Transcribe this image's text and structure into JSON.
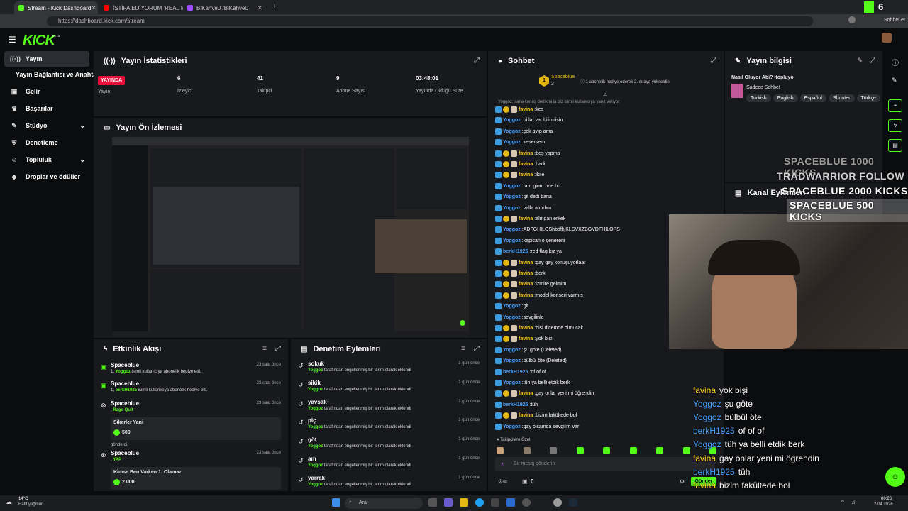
{
  "browser": {
    "tabs": [
      {
        "title": "Stream - Kick Dashboard",
        "color": "#53fc18"
      },
      {
        "title": "İSTİFA EDİYORUM 'REAL MADRİD'",
        "color": "#ff0000"
      },
      {
        "title": "BiKahve0 /BiKahve0",
        "color": "#a24bff"
      }
    ],
    "url": "https://dashboard.kick.com/stream",
    "profile_label": "Sohbet et"
  },
  "app": {
    "logo": "KICK",
    "logo_badge": "BETA"
  },
  "sidebar": {
    "items": [
      {
        "label": "Yayın",
        "icon": "broadcast-icon",
        "glyph": "((·))"
      },
      {
        "label": "Yayın Bağlantısı ve Anahtarı",
        "icon": "",
        "glyph": ""
      },
      {
        "label": "Gelir",
        "icon": "money-icon",
        "glyph": "▣"
      },
      {
        "label": "Başarılar",
        "icon": "trophy-icon",
        "glyph": "♛"
      },
      {
        "label": "Stüdyo",
        "icon": "studio-icon",
        "glyph": "✎"
      },
      {
        "label": "Denetleme",
        "icon": "shield-icon",
        "glyph": "⛨"
      },
      {
        "label": "Topluluk",
        "icon": "community-icon",
        "glyph": "☺"
      },
      {
        "label": "Droplar ve ödüller",
        "icon": "gift-icon",
        "glyph": "◆"
      }
    ]
  },
  "stats": {
    "title": "Yayın İstatistikleri",
    "live_badge": "YAYINDA",
    "items": [
      {
        "value": "",
        "label": "Yayın"
      },
      {
        "value": "6",
        "label": "İzleyici"
      },
      {
        "value": "41",
        "label": "Takipçi"
      },
      {
        "value": "9",
        "label": "Abone Sayısı"
      },
      {
        "value": "03:48:01",
        "label": "Yayında Olduğu Süre"
      }
    ]
  },
  "preview": {
    "title": "Yayın Ön İzlemesi"
  },
  "activity": {
    "title": "Etkinlik Akışı",
    "events": [
      {
        "name": "Spaceblue",
        "sub_prefix": "1, ",
        "sub_user": "Yoggoz",
        "sub_text": " isimli kullanıcıya abonelik hediye etti.",
        "time": "23 saat önce",
        "icon": "gift-icon"
      },
      {
        "name": "Spaceblue",
        "sub_prefix": "1, ",
        "sub_user": "berkH1925",
        "sub_text": " isimli kullanıcıya abonelik hediye etti.",
        "time": "23 saat önce",
        "icon": "gift-icon"
      },
      {
        "name": "Spaceblue",
        "sub_prefix": ", ",
        "sub_user": "Rage Quit",
        "sub_text": "",
        "time": "23 saat önce",
        "icon": "kick-icon",
        "card_title": "Sikerler Yani",
        "card_amount": "500",
        "card_footer": "gönderdi"
      },
      {
        "name": "Spaceblue",
        "sub_prefix": ", ",
        "sub_user": "YAP",
        "sub_text": "",
        "time": "23 saat önce",
        "icon": "kick-icon",
        "card_title": "Kimse Ben Varken 1. Olamaz",
        "card_amount": "2.000",
        "card_footer": ""
      }
    ]
  },
  "moderation": {
    "title": "Denetim Eylemleri",
    "actions": [
      {
        "term": "sokuk",
        "by": "Yoggoz",
        "text": " tarafından engellenmiş bir terim olarak eklendi",
        "time": "1 gün önce"
      },
      {
        "term": "sikik",
        "by": "Yoggoz",
        "text": " tarafından engellenmiş bir terim olarak eklendi",
        "time": "1 gün önce"
      },
      {
        "term": "yavşak",
        "by": "Yoggoz",
        "text": " tarafından engellenmiş bir terim olarak eklendi",
        "time": "1 gün önce"
      },
      {
        "term": "piç",
        "by": "Yoggoz",
        "text": " tarafından engellenmiş bir terim olarak eklendi",
        "time": "1 gün önce"
      },
      {
        "term": "göt",
        "by": "Yoggoz",
        "text": " tarafından engellenmiş bir terim olarak eklendi",
        "time": "1 gün önce"
      },
      {
        "term": "am",
        "by": "Yoggoz",
        "text": " tarafından engellenmiş bir terim olarak eklendi",
        "time": "1 gün önce"
      },
      {
        "term": "yarrak",
        "by": "Yoggoz",
        "text": " tarafından engellenmiş bir terim olarak eklendi",
        "time": "1 gün önce"
      }
    ]
  },
  "chat": {
    "title": "Sohbet",
    "pinned_user": "Spaceblue",
    "pinned_rank": "1",
    "pinned_count": "2",
    "pinned_text": "1 abonelik hediye ederek 2. sıraya yükseldin",
    "reply_hint": "Yoggoz: sana konuş dedikmi la biz isimli kullanıcıya yanıt veriyor",
    "messages": [
      {
        "user": "favina",
        "text": "kes",
        "color": "#ffd21f",
        "badges": 3
      },
      {
        "user": "Yoggoz",
        "text": "bi laf var bilirmisin",
        "color": "#4aa3ff",
        "badges": 1
      },
      {
        "user": "Yoggoz",
        "text": "çok ayıp ama",
        "color": "#4aa3ff",
        "badges": 1
      },
      {
        "user": "Yoggoz",
        "text": "kesersem",
        "color": "#4aa3ff",
        "badges": 1
      },
      {
        "user": "favina",
        "text": "boş yapma",
        "color": "#ffd21f",
        "badges": 3
      },
      {
        "user": "favina",
        "text": "hadi",
        "color": "#ffd21f",
        "badges": 3
      },
      {
        "user": "favina",
        "text": "ikile",
        "color": "#ffd21f",
        "badges": 3
      },
      {
        "user": "Yoggoz",
        "text": "tam giom bne bb",
        "color": "#4aa3ff",
        "badges": 1
      },
      {
        "user": "Yoggoz",
        "text": "git dedi bana",
        "color": "#4aa3ff",
        "badges": 1
      },
      {
        "user": "Yoggoz",
        "text": "valla alındım",
        "color": "#4aa3ff",
        "badges": 1
      },
      {
        "user": "favina",
        "text": "alıngan erkek",
        "color": "#ffd21f",
        "badges": 3
      },
      {
        "user": "Yoggoz",
        "text": "ADFGHILOShbdfhjKLSVXZBGVDFHILOPS",
        "color": "#4aa3ff",
        "badges": 1
      },
      {
        "user": "Yoggoz",
        "text": "kapican o çenereni",
        "color": "#4aa3ff",
        "badges": 1
      },
      {
        "user": "berkH1925",
        "text": "red flag kız ya",
        "color": "#4aa3ff",
        "badges": 1
      },
      {
        "user": "favina",
        "text": "gay gay konuşuyorlaar",
        "color": "#ffd21f",
        "badges": 3
      },
      {
        "user": "favina",
        "text": "berk",
        "color": "#ffd21f",
        "badges": 3
      },
      {
        "user": "favina",
        "text": "izmire gelmim",
        "color": "#ffd21f",
        "badges": 3
      },
      {
        "user": "favina",
        "text": "model konseri varmıs",
        "color": "#ffd21f",
        "badges": 3
      },
      {
        "user": "Yoggoz",
        "text": "git",
        "color": "#4aa3ff",
        "badges": 1
      },
      {
        "user": "Yoggoz",
        "text": "sevgilinle",
        "color": "#4aa3ff",
        "badges": 1
      },
      {
        "user": "favina",
        "text": "bişi dicemde olmucak",
        "color": "#ffd21f",
        "badges": 3
      },
      {
        "user": "favina",
        "text": "yok bişi",
        "color": "#ffd21f",
        "badges": 3
      },
      {
        "user": "Yoggoz",
        "text": "şu göte (Deleted)",
        "color": "#4aa3ff",
        "badges": 1
      },
      {
        "user": "Yoggoz",
        "text": "bülbül öte (Deleted)",
        "color": "#4aa3ff",
        "badges": 1
      },
      {
        "user": "berkH1925",
        "text": "of of of",
        "color": "#4aa3ff",
        "badges": 1
      },
      {
        "user": "Yoggoz",
        "text": "tüh ya belli etdik berk",
        "color": "#4aa3ff",
        "badges": 1
      },
      {
        "user": "favina",
        "text": "gay onlar yeni mi öğrendin",
        "color": "#ffd21f",
        "badges": 3
      },
      {
        "user": "berkH1925",
        "text": "tüh",
        "color": "#4aa3ff",
        "badges": 1
      },
      {
        "user": "favina",
        "text": "bizim fakültede bol",
        "color": "#ffd21f",
        "badges": 3
      },
      {
        "user": "Yoggoz",
        "text": "gay olsamda sevgilim var",
        "color": "#4aa3ff",
        "badges": 1
      }
    ],
    "emote_label": "Takipçilere Özel",
    "input_placeholder": "Bir mesaj gönderin",
    "send_label": "Gönder",
    "counter": "0"
  },
  "info": {
    "title": "Yayın bilgisi",
    "stream_title": "Nasıl Oluyor Abi? Itopluyo",
    "category": "Sadece Sohbet",
    "tags": [
      "Turkish",
      "English",
      "Español",
      "Shooter",
      "Türkçe"
    ],
    "actions_title": "Kanal Eylemleri"
  },
  "overlay": {
    "kicks": [
      {
        "text": "SPACEBLUE  1000 KICKS"
      },
      {
        "text": "TRADWARRIOR  FOLLOW"
      },
      {
        "text": "SPACEBLUE  2000 KICKS"
      },
      {
        "text": "SPACEBLUE  500 KICKS"
      }
    ],
    "chat": [
      {
        "user": "favina",
        "text": "yok bişi",
        "color": "#ffd21f"
      },
      {
        "user": "Yoggoz",
        "text": "şu göte",
        "color": "#4aa3ff"
      },
      {
        "user": "Yoggoz",
        "text": "bülbül öte",
        "color": "#4aa3ff"
      },
      {
        "user": "berkH1925",
        "text": "of of of",
        "color": "#4aa3ff"
      },
      {
        "user": "Yoggoz",
        "text": "tüh ya belli etdik berk",
        "color": "#4aa3ff"
      },
      {
        "user": "favina",
        "text": "gay onlar yeni mi öğrendin",
        "color": "#ffd21f"
      },
      {
        "user": "berkH1925",
        "text": "tüh",
        "color": "#4aa3ff"
      },
      {
        "user": "favina",
        "text": "bizim fakültede bol",
        "color": "#ffd21f"
      },
      {
        "user": "Yoggoz",
        "text": "gay olsamda sevgilim var",
        "color": "#4aa3ff"
      }
    ],
    "top_badge": "6"
  },
  "taskbar": {
    "weather_temp": "14°C",
    "weather_desc": "Hafif yağmur",
    "search_label": "Ara",
    "time": "00:23",
    "date": "2.04.2026"
  },
  "colors": {
    "accent": "#53fc18",
    "panel": "#18191c",
    "bg": "#0b0c0e",
    "live": "#e9113c"
  }
}
